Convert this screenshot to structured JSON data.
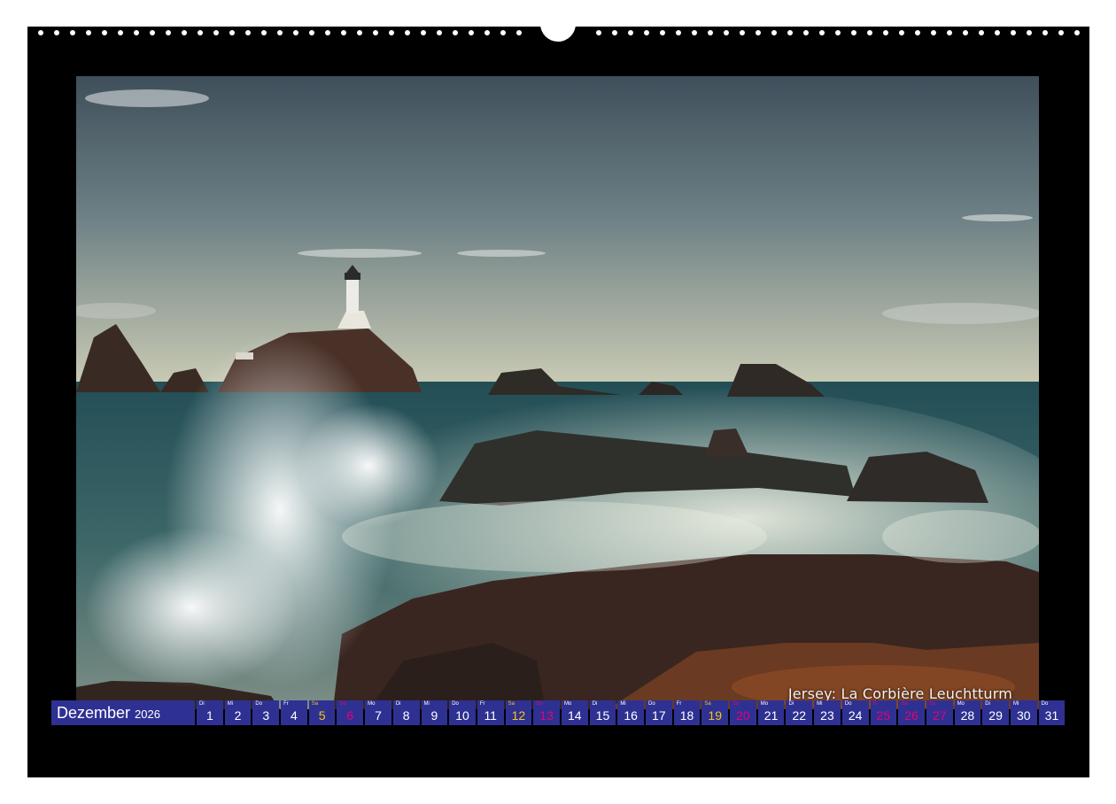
{
  "calendar": {
    "month": "Dezember",
    "year": "2026",
    "caption": "Jersey: La Corbière Leuchtturm",
    "colors": {
      "cell_bg": "#2e3192",
      "saturday": "#f5c518",
      "sunday_holiday": "#e4007c",
      "frame": "#000000"
    },
    "days": [
      {
        "wd": "Di",
        "n": "1",
        "t": "w"
      },
      {
        "wd": "Mi",
        "n": "2",
        "t": "w"
      },
      {
        "wd": "Do",
        "n": "3",
        "t": "w"
      },
      {
        "wd": "Fr",
        "n": "4",
        "t": "w"
      },
      {
        "wd": "Sa",
        "n": "5",
        "t": "sat"
      },
      {
        "wd": "So",
        "n": "6",
        "t": "sun"
      },
      {
        "wd": "Mo",
        "n": "7",
        "t": "w"
      },
      {
        "wd": "Di",
        "n": "8",
        "t": "w"
      },
      {
        "wd": "Mi",
        "n": "9",
        "t": "w"
      },
      {
        "wd": "Do",
        "n": "10",
        "t": "w"
      },
      {
        "wd": "Fr",
        "n": "11",
        "t": "w"
      },
      {
        "wd": "Sa",
        "n": "12",
        "t": "sat"
      },
      {
        "wd": "So",
        "n": "13",
        "t": "sun"
      },
      {
        "wd": "Mo",
        "n": "14",
        "t": "w"
      },
      {
        "wd": "Di",
        "n": "15",
        "t": "w"
      },
      {
        "wd": "Mi",
        "n": "16",
        "t": "w"
      },
      {
        "wd": "Do",
        "n": "17",
        "t": "w"
      },
      {
        "wd": "Fr",
        "n": "18",
        "t": "w"
      },
      {
        "wd": "Sa",
        "n": "19",
        "t": "sat"
      },
      {
        "wd": "So",
        "n": "20",
        "t": "sun"
      },
      {
        "wd": "Mo",
        "n": "21",
        "t": "w"
      },
      {
        "wd": "Di",
        "n": "22",
        "t": "w"
      },
      {
        "wd": "Mi",
        "n": "23",
        "t": "w"
      },
      {
        "wd": "Do",
        "n": "24",
        "t": "w"
      },
      {
        "wd": "Fr",
        "n": "25",
        "t": "hol"
      },
      {
        "wd": "Sa",
        "n": "26",
        "t": "hol"
      },
      {
        "wd": "So",
        "n": "27",
        "t": "sun"
      },
      {
        "wd": "Mo",
        "n": "28",
        "t": "w"
      },
      {
        "wd": "Di",
        "n": "29",
        "t": "w"
      },
      {
        "wd": "Mi",
        "n": "30",
        "t": "w"
      },
      {
        "wd": "Do",
        "n": "31",
        "t": "w"
      }
    ]
  }
}
